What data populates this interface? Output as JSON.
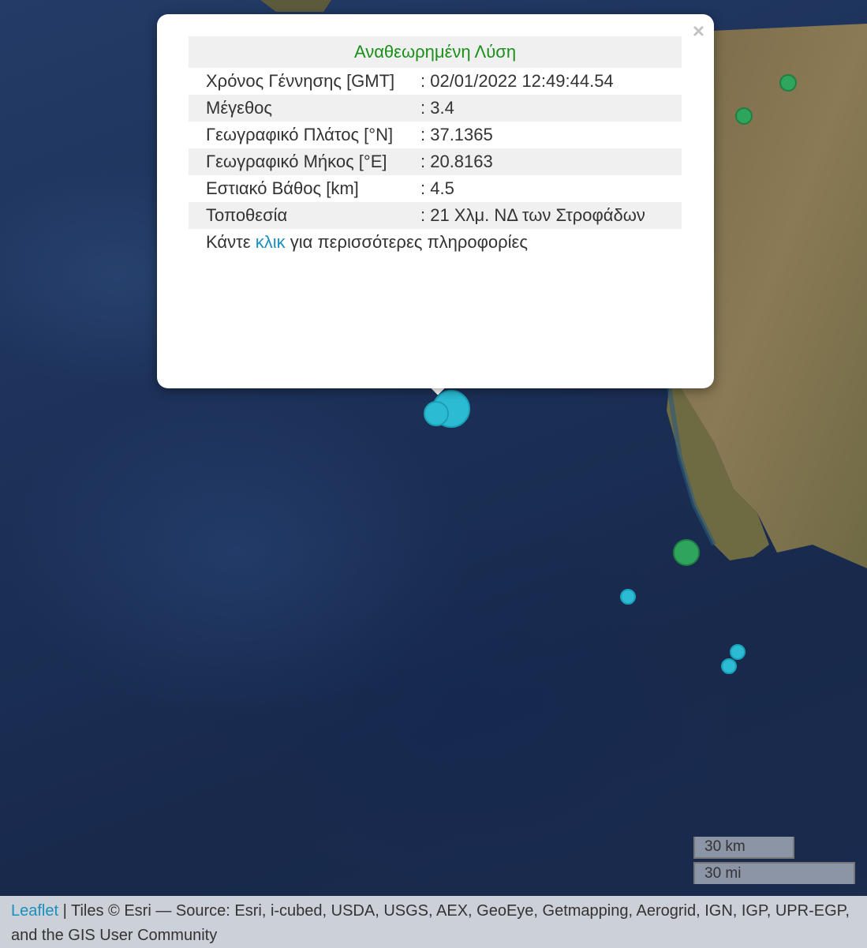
{
  "popup": {
    "title": "Αναθεωρημένη Λύση",
    "rows": [
      {
        "label": "Χρόνος Γέννησης [GMT]",
        "value": ": 02/01/2022 12:49:44.54"
      },
      {
        "label": "Μέγεθος",
        "value": ": 3.4"
      },
      {
        "label": "Γεωγραφικό Πλάτος [°N]",
        "value": ": 37.1365"
      },
      {
        "label": "Γεωγραφικό Μήκος [°E]",
        "value": ": 20.8163"
      },
      {
        "label": "Εστιακό Βάθος [km]",
        "value": ": 4.5"
      },
      {
        "label": "Τοποθεσία",
        "value": ": 21 Χλμ. ΝΔ των Στροφάδων"
      }
    ],
    "more_prefix": "Κάντε ",
    "more_link": "κλικ",
    "more_suffix": " για περισσότερες πληροφορίες",
    "close_symbol": "×"
  },
  "scale": {
    "km": "30 km",
    "mi": "30 mi"
  },
  "attribution": {
    "link": "Leaflet",
    "text": " | Tiles © Esri — Source: Esri, i-cubed, USDA, USGS, AEX, GeoEye, Getmapping, Aerogrid, IGN, IGP, UPR-EGP, and the GIS User Community"
  },
  "colors": {
    "marker_recent": "#2bbcd4",
    "marker_older": "#2fa45d",
    "link": "#1a8fbf",
    "popup_title": "#1a8f1a"
  }
}
